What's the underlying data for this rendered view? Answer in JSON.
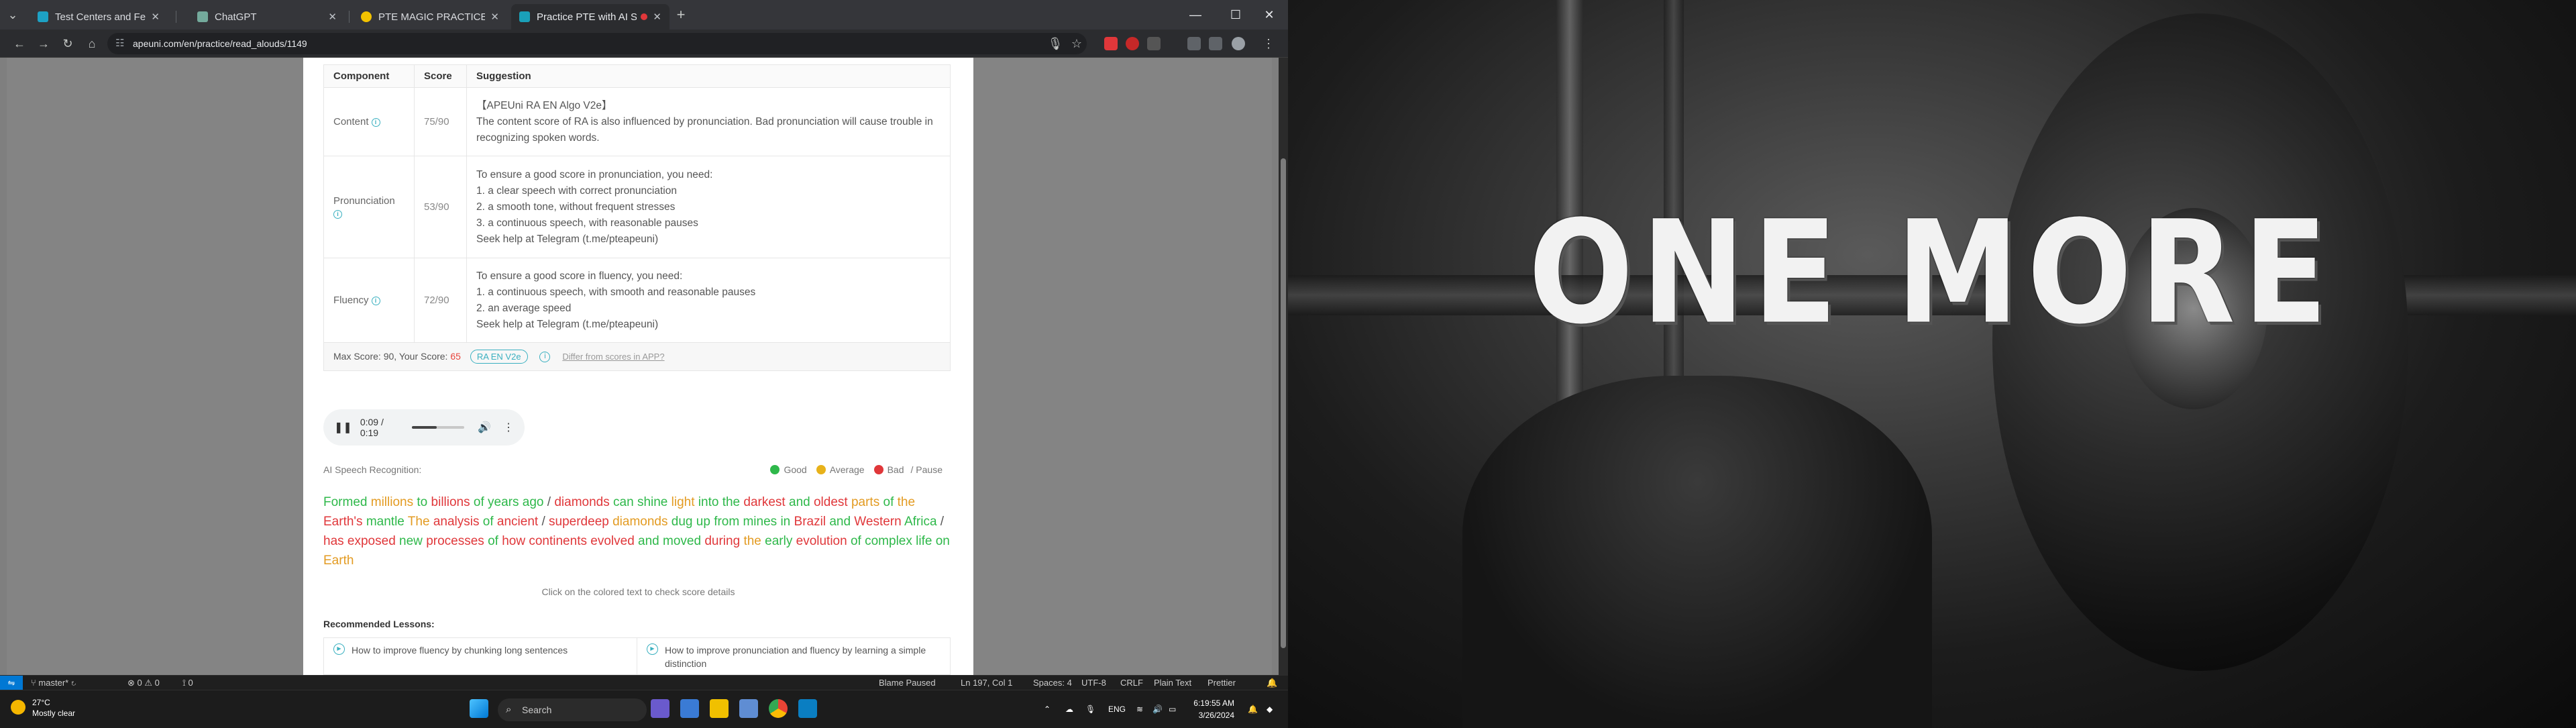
{
  "browser": {
    "tabs": [
      {
        "label": "Test Centers and Fees | Pearson",
        "favicon_color": "#1da1c4",
        "active": false
      },
      {
        "label": "ChatGPT",
        "favicon_color": "#74aa9c",
        "active": false
      },
      {
        "label": "PTE MAGIC PRACTICE",
        "favicon_color": "#f2c200",
        "active": false
      },
      {
        "label": "Practice PTE with AI Scoring",
        "favicon_color": "#1aa0b8",
        "active": true
      }
    ],
    "new_tab": "+",
    "close": "✕",
    "url": "apeuni.com/en/practice/read_alouds/1149",
    "window_controls": {
      "minimize": "—",
      "maximize": "☐",
      "close": "✕"
    }
  },
  "score_table": {
    "headers": {
      "component": "Component",
      "score": "Score",
      "suggestion": "Suggestion"
    },
    "rows": [
      {
        "component": "Content",
        "score": "75/90",
        "suggestion": [
          "【APEUni RA EN Algo V2e】",
          "The content score of RA is also influenced by pronunciation. Bad pronunciation will cause trouble in recognizing spoken words."
        ]
      },
      {
        "component": "Pronunciation",
        "score": "53/90",
        "suggestion": [
          "To ensure a good score in pronunciation, you need:",
          "1. a clear speech with correct pronunciation",
          "2. a smooth tone, without frequent stresses",
          "3. a continuous speech, with reasonable pauses",
          "Seek help at Telegram (t.me/pteapeuni)"
        ]
      },
      {
        "component": "Fluency",
        "score": "72/90",
        "suggestion": [
          "To ensure a good score in fluency, you need:",
          "1. a continuous speech, with smooth and reasonable pauses",
          "2. an average speed",
          "Seek help at Telegram (t.me/pteapeuni)"
        ]
      }
    ],
    "max_score_label": "Max Score:",
    "max_score": "90,",
    "your_score_label": "Your Score:",
    "your_score": "65",
    "algo_badge": "RA EN V2e",
    "differ_link": "Differ from scores in APP?"
  },
  "audio": {
    "time": "0:09 / 0:19",
    "progress": 0.47
  },
  "asr": {
    "label": "AI Speech Recognition:",
    "legend": [
      {
        "label": "Good",
        "color": "#2eb84a"
      },
      {
        "label": "Average",
        "color": "#e8b21a"
      },
      {
        "label": "Bad",
        "color": "#e0373a"
      }
    ],
    "pause_label": "/ Pause",
    "words": [
      {
        "t": "Formed",
        "q": "good"
      },
      {
        "t": "millions",
        "q": "avg"
      },
      {
        "t": "to",
        "q": "good"
      },
      {
        "t": "billions",
        "q": "bad"
      },
      {
        "t": "of",
        "q": "good"
      },
      {
        "t": "years",
        "q": "good"
      },
      {
        "t": "ago",
        "q": "good"
      },
      {
        "t": "/",
        "q": "pause"
      },
      {
        "t": "diamonds",
        "q": "bad"
      },
      {
        "t": "can",
        "q": "good"
      },
      {
        "t": "shine",
        "q": "good"
      },
      {
        "t": "light",
        "q": "avg"
      },
      {
        "t": "into",
        "q": "good"
      },
      {
        "t": "the",
        "q": "good"
      },
      {
        "t": "darkest",
        "q": "bad"
      },
      {
        "t": "and",
        "q": "good"
      },
      {
        "t": "oldest",
        "q": "bad"
      },
      {
        "t": "parts",
        "q": "avg"
      },
      {
        "t": "of",
        "q": "good"
      },
      {
        "t": "the",
        "q": "avg"
      },
      {
        "t": "Earth's",
        "q": "bad"
      },
      {
        "t": "mantle",
        "q": "good"
      },
      {
        "t": "The",
        "q": "avg"
      },
      {
        "t": "analysis",
        "q": "bad"
      },
      {
        "t": "of",
        "q": "good"
      },
      {
        "t": "ancient",
        "q": "bad"
      },
      {
        "t": "/",
        "q": "pause"
      },
      {
        "t": "superdeep",
        "q": "bad"
      },
      {
        "t": "diamonds",
        "q": "avg"
      },
      {
        "t": "dug",
        "q": "good"
      },
      {
        "t": "up",
        "q": "good"
      },
      {
        "t": "from",
        "q": "good"
      },
      {
        "t": "mines",
        "q": "good"
      },
      {
        "t": "in",
        "q": "good"
      },
      {
        "t": "Brazil",
        "q": "bad"
      },
      {
        "t": "and",
        "q": "good"
      },
      {
        "t": "Western",
        "q": "bad"
      },
      {
        "t": "Africa",
        "q": "good"
      },
      {
        "t": "/",
        "q": "pause"
      },
      {
        "t": "has",
        "q": "bad"
      },
      {
        "t": "exposed",
        "q": "bad"
      },
      {
        "t": "new",
        "q": "good"
      },
      {
        "t": "processes",
        "q": "bad"
      },
      {
        "t": "of",
        "q": "good"
      },
      {
        "t": "how",
        "q": "bad"
      },
      {
        "t": "continents",
        "q": "bad"
      },
      {
        "t": "evolved",
        "q": "bad"
      },
      {
        "t": "and",
        "q": "good"
      },
      {
        "t": "moved",
        "q": "good"
      },
      {
        "t": "during",
        "q": "bad"
      },
      {
        "t": "the",
        "q": "avg"
      },
      {
        "t": "early",
        "q": "good"
      },
      {
        "t": "evolution",
        "q": "bad"
      },
      {
        "t": "of",
        "q": "good"
      },
      {
        "t": "complex",
        "q": "good"
      },
      {
        "t": "life",
        "q": "good"
      },
      {
        "t": "on",
        "q": "good"
      },
      {
        "t": "Earth",
        "q": "avg"
      }
    ],
    "click_hint": "Click on the colored text to check score details"
  },
  "lessons": {
    "title": "Recommended Lessons:",
    "items": [
      {
        "label": "How to improve fluency by chunking long sentences"
      },
      {
        "label": "How to improve pronunciation and fluency by learning a simple distinction"
      }
    ]
  },
  "vscode_status": {
    "branch": "master*",
    "errors": "⊗ 0 ⚠ 0",
    "ports": "⟟ 0",
    "blame": "Blame Paused",
    "position": "Ln 197, Col 1",
    "spaces": "Spaces: 4",
    "encoding": "UTF-8",
    "eol": "CRLF",
    "language": "Plain Text",
    "formatter": "Prettier"
  },
  "taskbar": {
    "weather_temp": "27°C",
    "weather_desc": "Mostly clear",
    "search_placeholder": "Search",
    "language": "ENG",
    "time": "6:19:55 AM",
    "date": "3/26/2024"
  },
  "wallpaper": {
    "slogan": "ONE MORE"
  }
}
